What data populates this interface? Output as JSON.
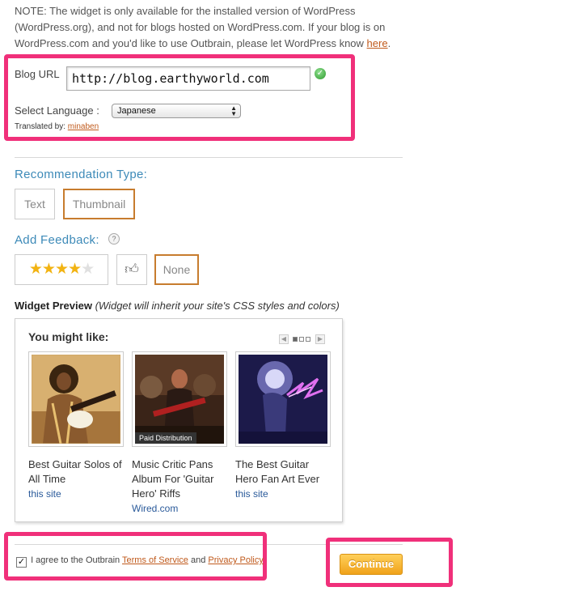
{
  "note": {
    "text": "NOTE: The widget is only available for the installed version of WordPress (WordPress.org), and not for blogs hosted on WordPress.com. If your blog is on WordPress.com and you'd like to use Outbrain, please let WordPress know ",
    "link": "here",
    "end": "."
  },
  "blog": {
    "url_label": "Blog URL",
    "url_value": "http://blog.earthyworld.com",
    "lang_label": "Select Language :",
    "lang_value": "Japanese",
    "translated_label": "Translated by: ",
    "translator": "minaben"
  },
  "recommendation": {
    "title": "Recommendation Type:",
    "options": [
      "Text",
      "Thumbnail"
    ],
    "selected": "Thumbnail"
  },
  "feedback": {
    "title": "Add Feedback:",
    "help": "?",
    "stars_rating": 4.5,
    "none_label": "None",
    "selected": "None"
  },
  "preview": {
    "title": "Widget Preview",
    "subtitle": "(Widget will inherit your site's CSS styles and colors)",
    "heading": "You might like:",
    "cards": [
      {
        "title": "Best Guitar Solos of All Time",
        "source": "this site"
      },
      {
        "title": "Music Critic Pans Album For 'Guitar Hero' Riffs",
        "source": "Wired.com",
        "badge": "Paid Distribution"
      },
      {
        "title": "The Best Guitar Hero Fan Art Ever",
        "source": "this site"
      }
    ]
  },
  "agreement": {
    "checked": true,
    "text1": "I agree to the Outbrain ",
    "tos": "Terms of Service",
    "and": " and ",
    "privacy": "Privacy Policy"
  },
  "continue_label": "Continue",
  "colors": {
    "accent": "#3d8ab8",
    "highlight": "#f0307a",
    "link": "#c05a1c",
    "selected_border": "#c77c2e",
    "button": "#f0a21a"
  }
}
